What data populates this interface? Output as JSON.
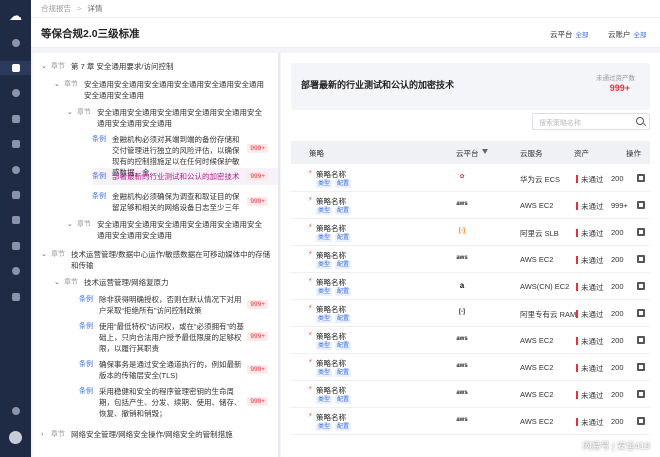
{
  "sidebar": {
    "icons": [
      "logo-icon",
      "home-icon",
      "compliance-icon",
      "security-icon",
      "settings-icon",
      "policy-icon",
      "report-icon",
      "network-icon",
      "asset-icon",
      "audit-icon",
      "alert-icon",
      "storage-icon",
      "tool-icon",
      "help-icon"
    ]
  },
  "breadcrumb": {
    "root": "合规报告",
    "separator": ">",
    "current": "详情"
  },
  "header": {
    "title": "等保合规2.0三级标准",
    "cloud_label": "云平台",
    "cloud_value": "全部",
    "account_label": "云账户",
    "account_value": "全部"
  },
  "tree": {
    "tags": {
      "chapter": "章节",
      "article": "条例"
    },
    "items": [
      {
        "level": 0,
        "tag": "章节",
        "text": "第 7 章  安全通用要求/访问控制"
      },
      {
        "level": 1,
        "tag": "章节",
        "text": "安全通用安全通用安全通用安全通用安全通用安全通用安全通用安全通用"
      },
      {
        "level": 2,
        "tag": "章节",
        "text": "安全通用安全通用安全通用安全通用安全通用安全通用安全通用安全通用"
      },
      {
        "level": 3,
        "tag": "条例",
        "text": "金融机构必须对其端到端的备份存储和交付管理进行独立的风险评估，以确保现有的控制措施足以在任何时候保护敏感数据，金...",
        "count": "999+"
      },
      {
        "level": 3,
        "tag": "条例",
        "text": "部署最新的行业测试和公认的加密技术",
        "count": "999+",
        "selected": true
      },
      {
        "level": 3,
        "tag": "条例",
        "text": "金融机构必须确保为调查和取证目的保留足够和相关的网络设备日志至少三年",
        "count": "999+"
      },
      {
        "level": 2,
        "tag": "章节",
        "text": "安全通用安全通用安全通用安全通用安全通用安全通用安全通用安全通用"
      },
      {
        "level": 0,
        "tag": "章节",
        "text": "技术运营管理/数据中心运作/敏感数据在可移动媒体中的存储和传输"
      },
      {
        "level": 1,
        "tag": "章节",
        "text": "技术运营管理/网络复原力"
      },
      {
        "level": 2,
        "tag": "条例",
        "text": "除非获得明确授权，否则在默认情况下对用户采取“拒绝所有”访问控制政策",
        "count": "999+"
      },
      {
        "level": 2,
        "tag": "条例",
        "text": "使用“最低特权”访问权，或在“必须拥有”的基础上，只向合法用户授予最低限度的足够权限，以履行其职责",
        "count": "999+"
      },
      {
        "level": 2,
        "tag": "条例",
        "text": "确保事务是通过安全通道执行的，例如最新版本的传输层安全(TLS)",
        "count": "999+"
      },
      {
        "level": 2,
        "tag": "条例",
        "text": "采用稳健和安全的程序管理密钥的生命周期，包括产生、分发、续期、使用、储存、恢复、撤销和销毁；",
        "count": "999+"
      },
      {
        "level": 0,
        "tag": "章节",
        "text": "网络安全管理/网络安全操作/网络安全的管制措施",
        "collapsed": true
      }
    ]
  },
  "detail": {
    "title": "部署最新的行业测试和公认的加密技术",
    "failed_assets_label": "未通过资产数",
    "failed_assets_count": "999+",
    "search_placeholder": "搜索策略名称",
    "columns": {
      "policy": "策略",
      "cloud": "云平台",
      "service": "云服务",
      "assets": "资产",
      "action": "操作"
    },
    "rows": [
      {
        "name": "策略名称",
        "chip1": "类型",
        "chip2": "配置",
        "provider": "huawei",
        "service": "华为云 ECS",
        "status": "未通过",
        "count": "200"
      },
      {
        "name": "策略名称",
        "chip1": "类型",
        "chip2": "配置",
        "provider": "aws",
        "service": "AWS EC2",
        "status": "未通过",
        "count": "999+"
      },
      {
        "name": "策略名称",
        "chip1": "类型",
        "chip2": "配置",
        "provider": "aliyun",
        "service": "阿里云 SLB",
        "status": "未通过",
        "count": "200"
      },
      {
        "name": "策略名称",
        "chip1": "类型",
        "chip2": "配置",
        "provider": "aws",
        "service": "AWS EC2",
        "status": "未通过",
        "count": "200"
      },
      {
        "name": "策略名称",
        "chip1": "类型",
        "chip2": "配置",
        "provider": "amazon",
        "service": "AWS(CN) EC2",
        "status": "未通过",
        "count": "200"
      },
      {
        "name": "策略名称",
        "chip1": "类型",
        "chip2": "配置",
        "provider": "aliyun-private",
        "service": "阿里专有云 RAM",
        "status": "未通过",
        "count": "200"
      },
      {
        "name": "策略名称",
        "chip1": "类型",
        "chip2": "配置",
        "provider": "aws",
        "service": "AWS EC2",
        "status": "未通过",
        "count": "200"
      },
      {
        "name": "策略名称",
        "chip1": "类型",
        "chip2": "配置",
        "provider": "aws",
        "service": "AWS EC2",
        "status": "未通过",
        "count": "200"
      },
      {
        "name": "策略名称",
        "chip1": "类型",
        "chip2": "配置",
        "provider": "aws",
        "service": "AWS EC2",
        "status": "未通过",
        "count": "200"
      },
      {
        "name": "策略名称",
        "chip1": "类型",
        "chip2": "配置",
        "provider": "aws",
        "service": "AWS EC2",
        "status": "未通过",
        "count": "200"
      }
    ]
  },
  "watermark": "网易号 | 安全419"
}
